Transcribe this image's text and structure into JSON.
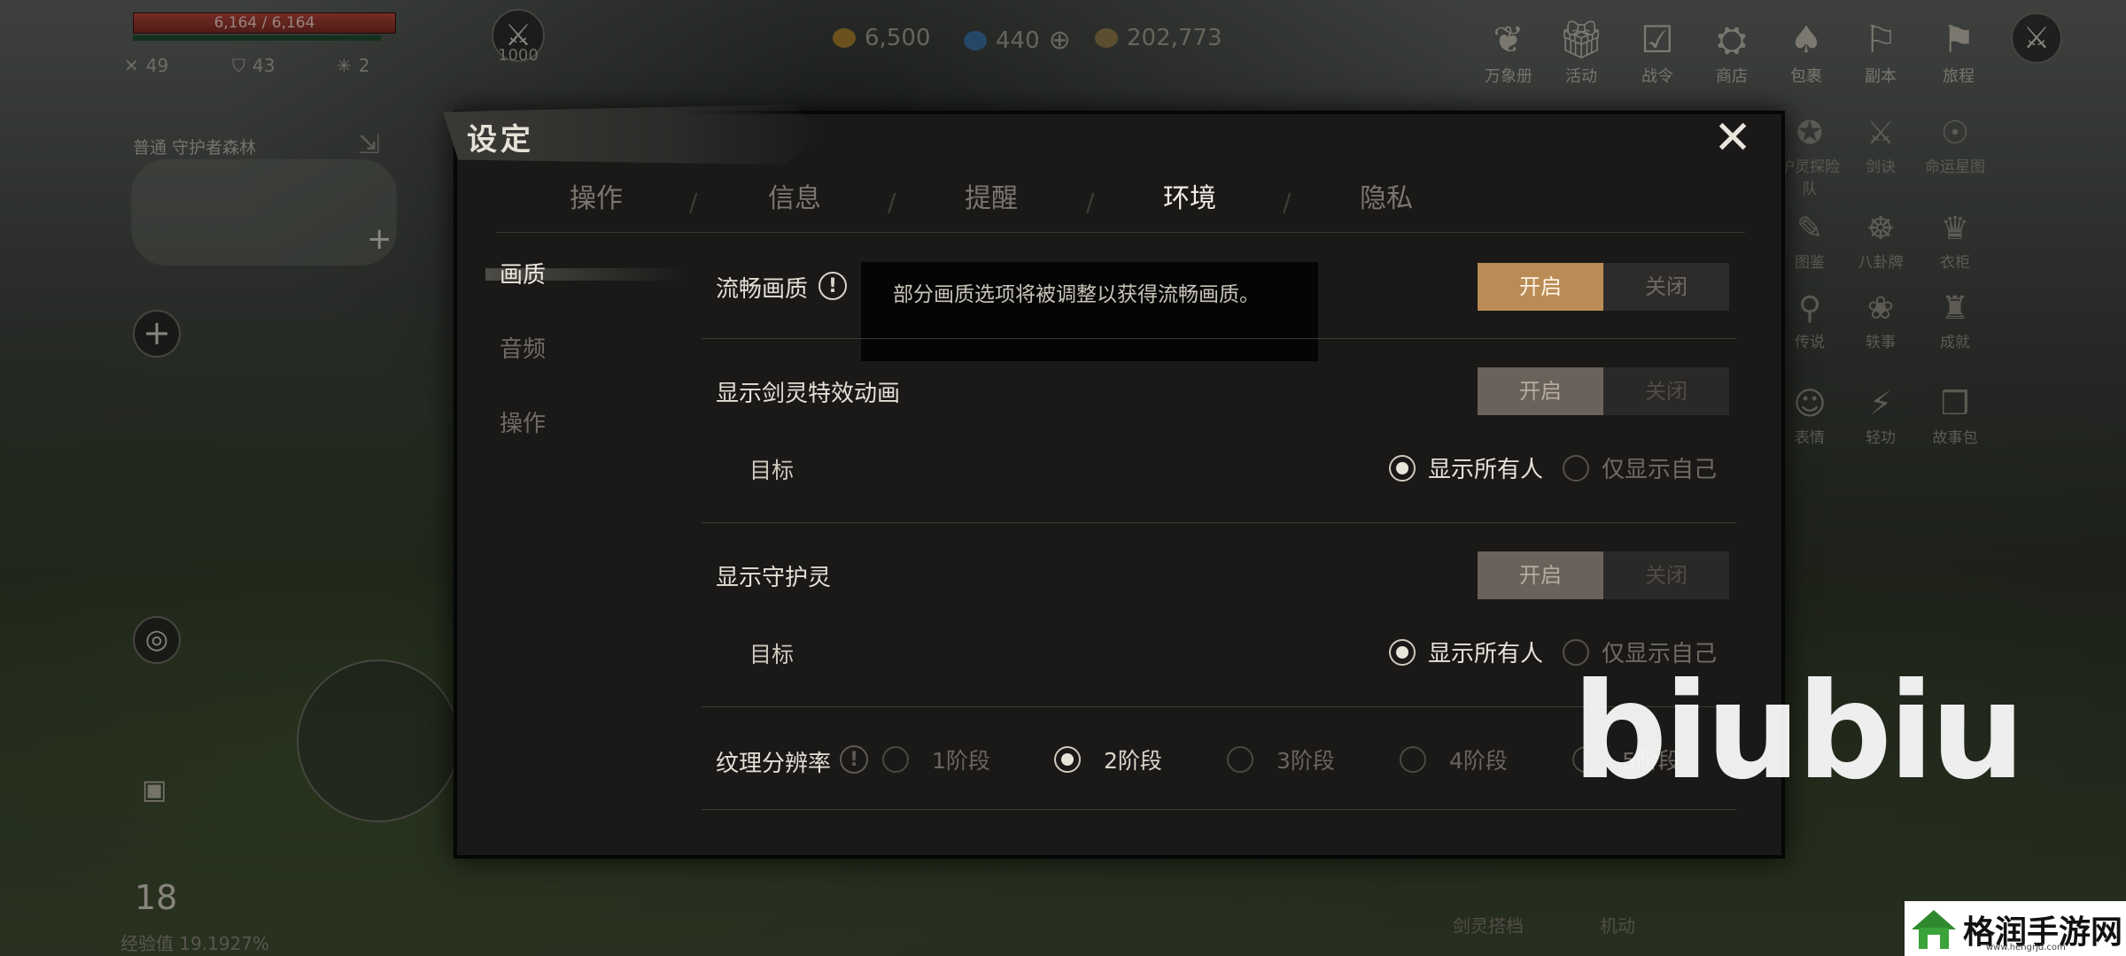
{
  "hud": {
    "hp_text": "6,164 / 6,164",
    "stats": [
      "49",
      "43",
      "2"
    ],
    "level_badge": "1000",
    "currency": [
      "6,500",
      "440",
      "202,773"
    ],
    "map_label": "普通  守护者森林",
    "bottom_level": "18",
    "exp_text": "经验值 19.1927%",
    "top_icons": [
      {
        "label": "万象册",
        "icon": "book-icon"
      },
      {
        "label": "活动",
        "icon": "gift-icon"
      },
      {
        "label": "战令",
        "icon": "checklist-icon"
      },
      {
        "label": "商店",
        "icon": "shop-icon"
      },
      {
        "label": "包裹",
        "icon": "bag-icon"
      },
      {
        "label": "副本",
        "icon": "dungeon-icon"
      },
      {
        "label": "旅程",
        "icon": "journey-icon"
      }
    ],
    "side_icons": [
      {
        "label": "护灵探险队",
        "icon": "team-icon"
      },
      {
        "label": "剑诀",
        "icon": "sword-icon"
      },
      {
        "label": "命运星图",
        "icon": "star-map-icon"
      },
      {
        "label": "图鉴",
        "icon": "codex-icon"
      },
      {
        "label": "八卦牌",
        "icon": "bagua-icon"
      },
      {
        "label": "衣柜",
        "icon": "wardrobe-icon"
      },
      {
        "label": "传说",
        "icon": "legend-icon"
      },
      {
        "label": "轶事",
        "icon": "anecdote-icon"
      },
      {
        "label": "成就",
        "icon": "achievement-icon"
      },
      {
        "label": "表情",
        "icon": "emote-icon"
      },
      {
        "label": "轻功",
        "icon": "qinggong-icon"
      },
      {
        "label": "故事包",
        "icon": "storybook-icon"
      }
    ],
    "bottom_labels": [
      "剑灵搭档",
      "机动"
    ]
  },
  "dialog": {
    "title": "设定",
    "tabs": [
      "操作",
      "信息",
      "提醒",
      "环境",
      "隐私"
    ],
    "active_tab": 3,
    "side_nav": [
      "画质",
      "音频",
      "操作"
    ],
    "rows": {
      "smooth": {
        "label": "流畅画质",
        "on": "开启",
        "off": "关闭"
      },
      "tooltip": "部分画质选项将被调整以获得流畅画质。",
      "spirit_anim": {
        "label": "显示剑灵特效动画",
        "on": "开启",
        "off": "关闭"
      },
      "target1": {
        "label": "目标",
        "opt_all": "显示所有人",
        "opt_self": "仅显示自己"
      },
      "guardian": {
        "label": "显示守护灵",
        "on": "开启",
        "off": "关闭"
      },
      "target2": {
        "label": "目标",
        "opt_all": "显示所有人",
        "opt_self": "仅显示自己"
      },
      "texture": {
        "label": "纹理分辨率",
        "options": [
          "1阶段",
          "2阶段",
          "3阶段",
          "4阶段",
          "5阶段"
        ],
        "selected": 1
      }
    }
  },
  "watermark": {
    "text": "biubiu",
    "site_name": "格润手游网",
    "site_url": "www.hengrjd.com"
  }
}
